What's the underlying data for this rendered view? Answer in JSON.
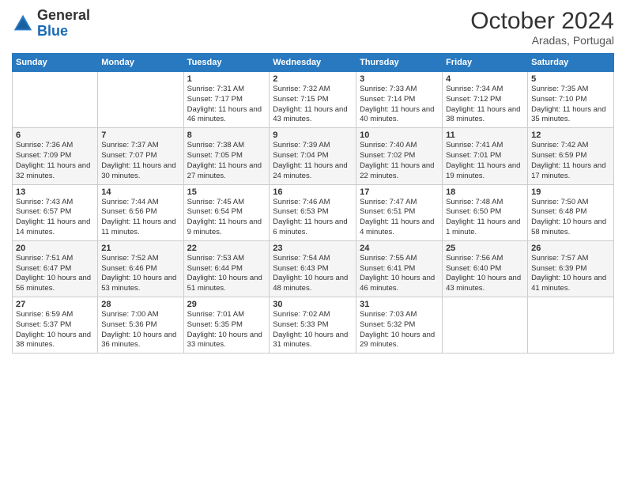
{
  "logo": {
    "general": "General",
    "blue": "Blue"
  },
  "header": {
    "month_year": "October 2024",
    "location": "Aradas, Portugal"
  },
  "weekdays": [
    "Sunday",
    "Monday",
    "Tuesday",
    "Wednesday",
    "Thursday",
    "Friday",
    "Saturday"
  ],
  "weeks": [
    [
      {
        "day": "",
        "info": ""
      },
      {
        "day": "",
        "info": ""
      },
      {
        "day": "1",
        "info": "Sunrise: 7:31 AM\nSunset: 7:17 PM\nDaylight: 11 hours and 46 minutes."
      },
      {
        "day": "2",
        "info": "Sunrise: 7:32 AM\nSunset: 7:15 PM\nDaylight: 11 hours and 43 minutes."
      },
      {
        "day": "3",
        "info": "Sunrise: 7:33 AM\nSunset: 7:14 PM\nDaylight: 11 hours and 40 minutes."
      },
      {
        "day": "4",
        "info": "Sunrise: 7:34 AM\nSunset: 7:12 PM\nDaylight: 11 hours and 38 minutes."
      },
      {
        "day": "5",
        "info": "Sunrise: 7:35 AM\nSunset: 7:10 PM\nDaylight: 11 hours and 35 minutes."
      }
    ],
    [
      {
        "day": "6",
        "info": "Sunrise: 7:36 AM\nSunset: 7:09 PM\nDaylight: 11 hours and 32 minutes."
      },
      {
        "day": "7",
        "info": "Sunrise: 7:37 AM\nSunset: 7:07 PM\nDaylight: 11 hours and 30 minutes."
      },
      {
        "day": "8",
        "info": "Sunrise: 7:38 AM\nSunset: 7:05 PM\nDaylight: 11 hours and 27 minutes."
      },
      {
        "day": "9",
        "info": "Sunrise: 7:39 AM\nSunset: 7:04 PM\nDaylight: 11 hours and 24 minutes."
      },
      {
        "day": "10",
        "info": "Sunrise: 7:40 AM\nSunset: 7:02 PM\nDaylight: 11 hours and 22 minutes."
      },
      {
        "day": "11",
        "info": "Sunrise: 7:41 AM\nSunset: 7:01 PM\nDaylight: 11 hours and 19 minutes."
      },
      {
        "day": "12",
        "info": "Sunrise: 7:42 AM\nSunset: 6:59 PM\nDaylight: 11 hours and 17 minutes."
      }
    ],
    [
      {
        "day": "13",
        "info": "Sunrise: 7:43 AM\nSunset: 6:57 PM\nDaylight: 11 hours and 14 minutes."
      },
      {
        "day": "14",
        "info": "Sunrise: 7:44 AM\nSunset: 6:56 PM\nDaylight: 11 hours and 11 minutes."
      },
      {
        "day": "15",
        "info": "Sunrise: 7:45 AM\nSunset: 6:54 PM\nDaylight: 11 hours and 9 minutes."
      },
      {
        "day": "16",
        "info": "Sunrise: 7:46 AM\nSunset: 6:53 PM\nDaylight: 11 hours and 6 minutes."
      },
      {
        "day": "17",
        "info": "Sunrise: 7:47 AM\nSunset: 6:51 PM\nDaylight: 11 hours and 4 minutes."
      },
      {
        "day": "18",
        "info": "Sunrise: 7:48 AM\nSunset: 6:50 PM\nDaylight: 11 hours and 1 minute."
      },
      {
        "day": "19",
        "info": "Sunrise: 7:50 AM\nSunset: 6:48 PM\nDaylight: 10 hours and 58 minutes."
      }
    ],
    [
      {
        "day": "20",
        "info": "Sunrise: 7:51 AM\nSunset: 6:47 PM\nDaylight: 10 hours and 56 minutes."
      },
      {
        "day": "21",
        "info": "Sunrise: 7:52 AM\nSunset: 6:46 PM\nDaylight: 10 hours and 53 minutes."
      },
      {
        "day": "22",
        "info": "Sunrise: 7:53 AM\nSunset: 6:44 PM\nDaylight: 10 hours and 51 minutes."
      },
      {
        "day": "23",
        "info": "Sunrise: 7:54 AM\nSunset: 6:43 PM\nDaylight: 10 hours and 48 minutes."
      },
      {
        "day": "24",
        "info": "Sunrise: 7:55 AM\nSunset: 6:41 PM\nDaylight: 10 hours and 46 minutes."
      },
      {
        "day": "25",
        "info": "Sunrise: 7:56 AM\nSunset: 6:40 PM\nDaylight: 10 hours and 43 minutes."
      },
      {
        "day": "26",
        "info": "Sunrise: 7:57 AM\nSunset: 6:39 PM\nDaylight: 10 hours and 41 minutes."
      }
    ],
    [
      {
        "day": "27",
        "info": "Sunrise: 6:59 AM\nSunset: 5:37 PM\nDaylight: 10 hours and 38 minutes."
      },
      {
        "day": "28",
        "info": "Sunrise: 7:00 AM\nSunset: 5:36 PM\nDaylight: 10 hours and 36 minutes."
      },
      {
        "day": "29",
        "info": "Sunrise: 7:01 AM\nSunset: 5:35 PM\nDaylight: 10 hours and 33 minutes."
      },
      {
        "day": "30",
        "info": "Sunrise: 7:02 AM\nSunset: 5:33 PM\nDaylight: 10 hours and 31 minutes."
      },
      {
        "day": "31",
        "info": "Sunrise: 7:03 AM\nSunset: 5:32 PM\nDaylight: 10 hours and 29 minutes."
      },
      {
        "day": "",
        "info": ""
      },
      {
        "day": "",
        "info": ""
      }
    ]
  ]
}
